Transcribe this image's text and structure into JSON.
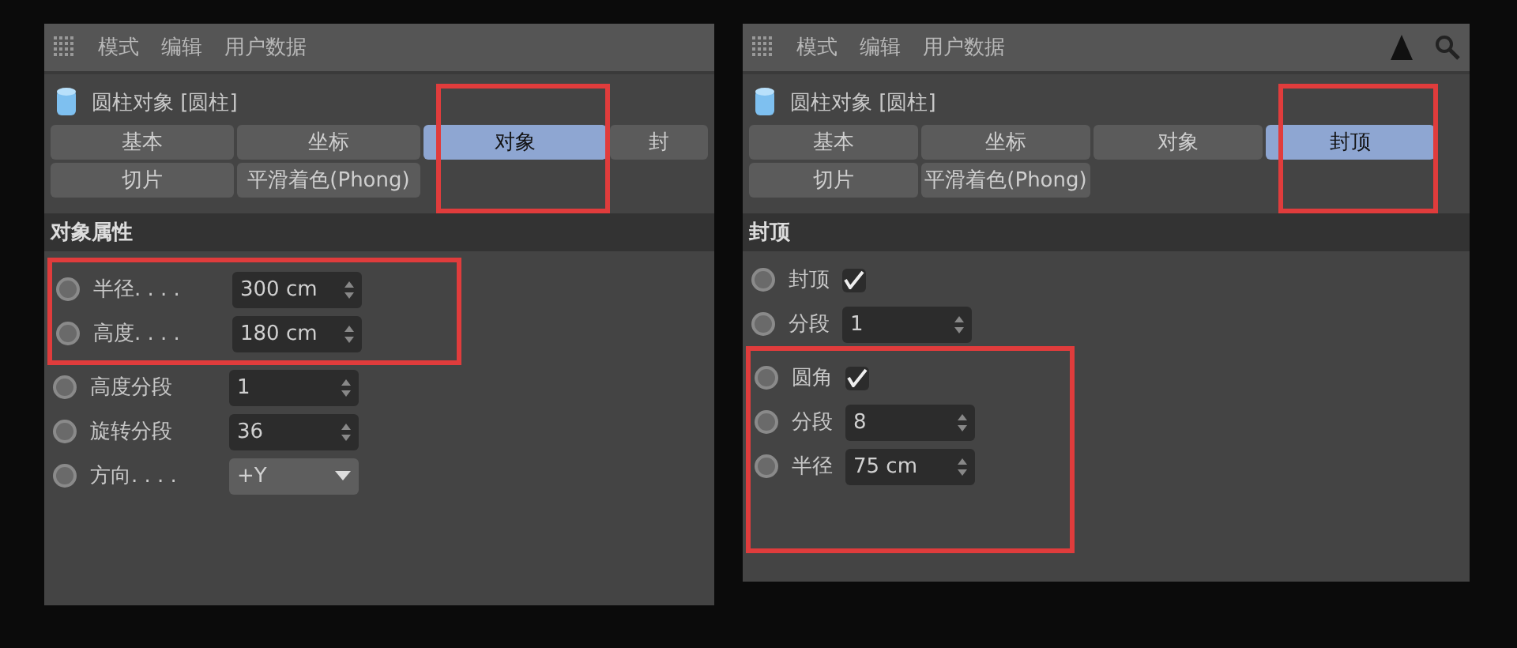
{
  "panels": [
    {
      "menu": [
        "模式",
        "编辑",
        "用户数据"
      ],
      "tools": false,
      "title": "圆柱对象 [圆柱]",
      "tabs": [
        {
          "label": "基本",
          "selected": false,
          "highlighted": false
        },
        {
          "label": "坐标",
          "selected": false,
          "highlighted": false
        },
        {
          "label": "对象",
          "selected": true,
          "highlighted": true
        },
        {
          "label": "封",
          "selected": false,
          "highlighted": false
        },
        {
          "label": "切片",
          "selected": false,
          "highlighted": false
        },
        {
          "label": "平滑着色(Phong)",
          "selected": false,
          "highlighted": false
        }
      ],
      "section": "对象属性",
      "groups": [
        {
          "highlighted": true,
          "rows": [
            {
              "kind": "number",
              "label": "半径. . . .",
              "value": "300 cm"
            },
            {
              "kind": "number",
              "label": "高度. . . .",
              "value": "180 cm"
            }
          ]
        },
        {
          "highlighted": false,
          "rows": [
            {
              "kind": "number",
              "label": "高度分段",
              "value": "1"
            },
            {
              "kind": "number",
              "label": "旋转分段",
              "value": "36"
            },
            {
              "kind": "dropdown",
              "label": "方向. . . .",
              "value": "+Y"
            }
          ]
        }
      ]
    },
    {
      "menu": [
        "模式",
        "编辑",
        "用户数据"
      ],
      "tools": true,
      "title": "圆柱对象 [圆柱]",
      "tabs": [
        {
          "label": "基本",
          "selected": false,
          "highlighted": false
        },
        {
          "label": "坐标",
          "selected": false,
          "highlighted": false
        },
        {
          "label": "对象",
          "selected": false,
          "highlighted": false
        },
        {
          "label": "封顶",
          "selected": true,
          "highlighted": true
        },
        {
          "label": "切片",
          "selected": false,
          "highlighted": false
        },
        {
          "label": "平滑着色(Phong)",
          "selected": false,
          "highlighted": false
        }
      ],
      "section": "封顶",
      "groups": [
        {
          "highlighted": false,
          "rows": [
            {
              "kind": "check",
              "label": "封顶",
              "checked": true
            },
            {
              "kind": "number",
              "label": "分段",
              "value": "1"
            }
          ]
        },
        {
          "highlighted": true,
          "rows": [
            {
              "kind": "check",
              "label": "圆角",
              "checked": true
            },
            {
              "kind": "number",
              "label": "分段",
              "value": "8"
            },
            {
              "kind": "number",
              "label": "半径",
              "value": "75 cm"
            }
          ]
        }
      ]
    }
  ]
}
